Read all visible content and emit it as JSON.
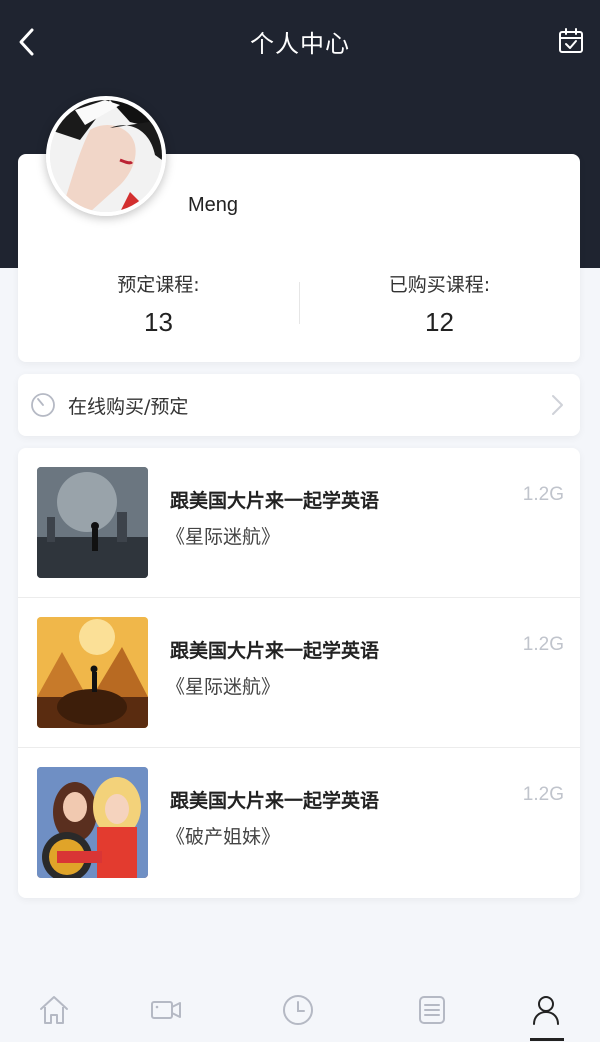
{
  "header": {
    "title": "个人中心",
    "back_icon": "chevron-left-icon",
    "calendar_icon": "calendar-check-icon"
  },
  "profile": {
    "username": "Meng",
    "avatar": "avatar",
    "stats": [
      {
        "label": "预定课程:",
        "value": "13"
      },
      {
        "label": "已购买课程:",
        "value": "12"
      }
    ]
  },
  "purchase": {
    "icon": "timer-icon",
    "label": "在线购买/预定",
    "chevron": "chevron-right-icon"
  },
  "courses": [
    {
      "title": "跟美国大片来一起学英语",
      "subtitle": "《星际迷航》",
      "size": "1.2G"
    },
    {
      "title": "跟美国大片来一起学英语",
      "subtitle": "《星际迷航》",
      "size": "1.2G"
    },
    {
      "title": "跟美国大片来一起学英语",
      "subtitle": "《破产姐妹》",
      "size": "1.2G"
    }
  ],
  "tabbar": {
    "items": [
      "home-icon",
      "video-icon",
      "clock-icon",
      "list-icon",
      "user-icon"
    ],
    "active": "user-icon"
  },
  "colors": {
    "header_bg": "#1f2430",
    "page_bg": "#f4f6fa",
    "muted": "#c0c4cc"
  }
}
